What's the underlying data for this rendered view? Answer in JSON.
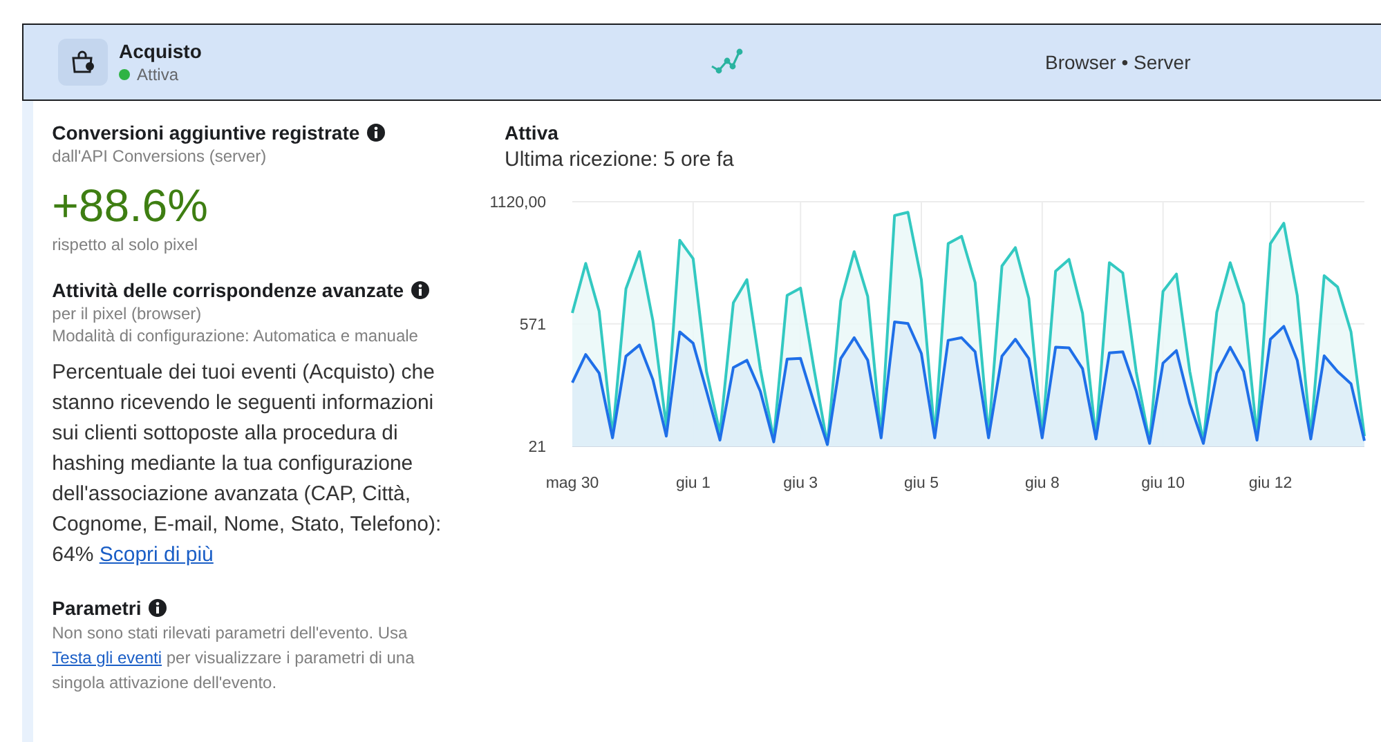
{
  "event": {
    "name": "Acquisto",
    "status": "Attiva",
    "active": true,
    "sources": "Browser • Server"
  },
  "conversions": {
    "title": "Conversioni aggiuntive registrate",
    "subtitle": "dall'API Conversions (server)",
    "value": "+88.6%",
    "caption": "rispetto al solo pixel"
  },
  "matching": {
    "title": "Attività delle corrispondenze avanzate",
    "subtitle": "per il pixel (browser)",
    "mode": "Modalità di configurazione: Automatica e manuale",
    "text": "Percentuale dei tuoi eventi (Acquisto) che stanno ricevendo le seguenti informazioni sui clienti sottoposte alla procedura di hashing mediante la tua configurazione dell'associazione avanzata (CAP, Città, Cognome, E-mail, Nome, Stato, Telefono): 64%",
    "link": "Scopri di più"
  },
  "parameters": {
    "title": "Parametri",
    "text_before": "Non sono stati rilevati parametri dell'evento. Usa",
    "link": "Testa gli eventi",
    "text_after": "per visualizzare i parametri di una singola attivazione dell'evento."
  },
  "activity": {
    "title": "Attiva",
    "last_received": "Ultima ricezione: 5 ore fa",
    "chart_data": {
      "type": "area",
      "categories": [
        "mag 30",
        null,
        null,
        null,
        null,
        null,
        null,
        null,
        null,
        "giu 1",
        null,
        null,
        null,
        null,
        null,
        null,
        null,
        "giu 3",
        null,
        null,
        null,
        null,
        null,
        null,
        null,
        null,
        "giu 5",
        null,
        null,
        null,
        null,
        null,
        null,
        null,
        null,
        "giu 8",
        null,
        null,
        null,
        null,
        null,
        null,
        null,
        null,
        "giu 10",
        null,
        null,
        null,
        null,
        null,
        null,
        null,
        "giu 12",
        null,
        null,
        null,
        null,
        null,
        null,
        null
      ],
      "series": [
        {
          "color": "#33c9c1",
          "values": [
            620,
            843,
            628,
            67,
            729,
            896,
            585,
            110,
            947,
            864,
            357,
            80,
            666,
            770,
            370,
            54,
            699,
            732,
            370,
            29,
            674,
            896,
            694,
            67,
            1058,
            1073,
            770,
            67,
            932,
            965,
            757,
            67,
            831,
            914,
            686,
            67,
            808,
            861,
            618,
            59,
            846,
            800,
            357,
            41,
            717,
            795,
            357,
            41,
            623,
            846,
            661,
            67,
            932,
            1023,
            699,
            67,
            788,
            737,
            535,
            67
          ]
        },
        {
          "color": "#1f6fe8",
          "values": [
            307,
            433,
            350,
            59,
            426,
            476,
            320,
            67,
            535,
            484,
            269,
            49,
            375,
            408,
            269,
            41,
            413,
            416,
            218,
            29,
            416,
            509,
            408,
            59,
            580,
            573,
            438,
            59,
            497,
            509,
            446,
            59,
            426,
            502,
            416,
            59,
            466,
            464,
            370,
            54,
            441,
            446,
            269,
            34,
            395,
            451,
            213,
            34,
            350,
            466,
            357,
            49,
            502,
            560,
            408,
            54,
            428,
            357,
            302,
            46
          ]
        }
      ],
      "ylim": [
        21,
        1120
      ],
      "grid": true,
      "yticks": [
        21,
        571,
        {
          "value": 1120,
          "label": "1120,00"
        }
      ]
    }
  }
}
